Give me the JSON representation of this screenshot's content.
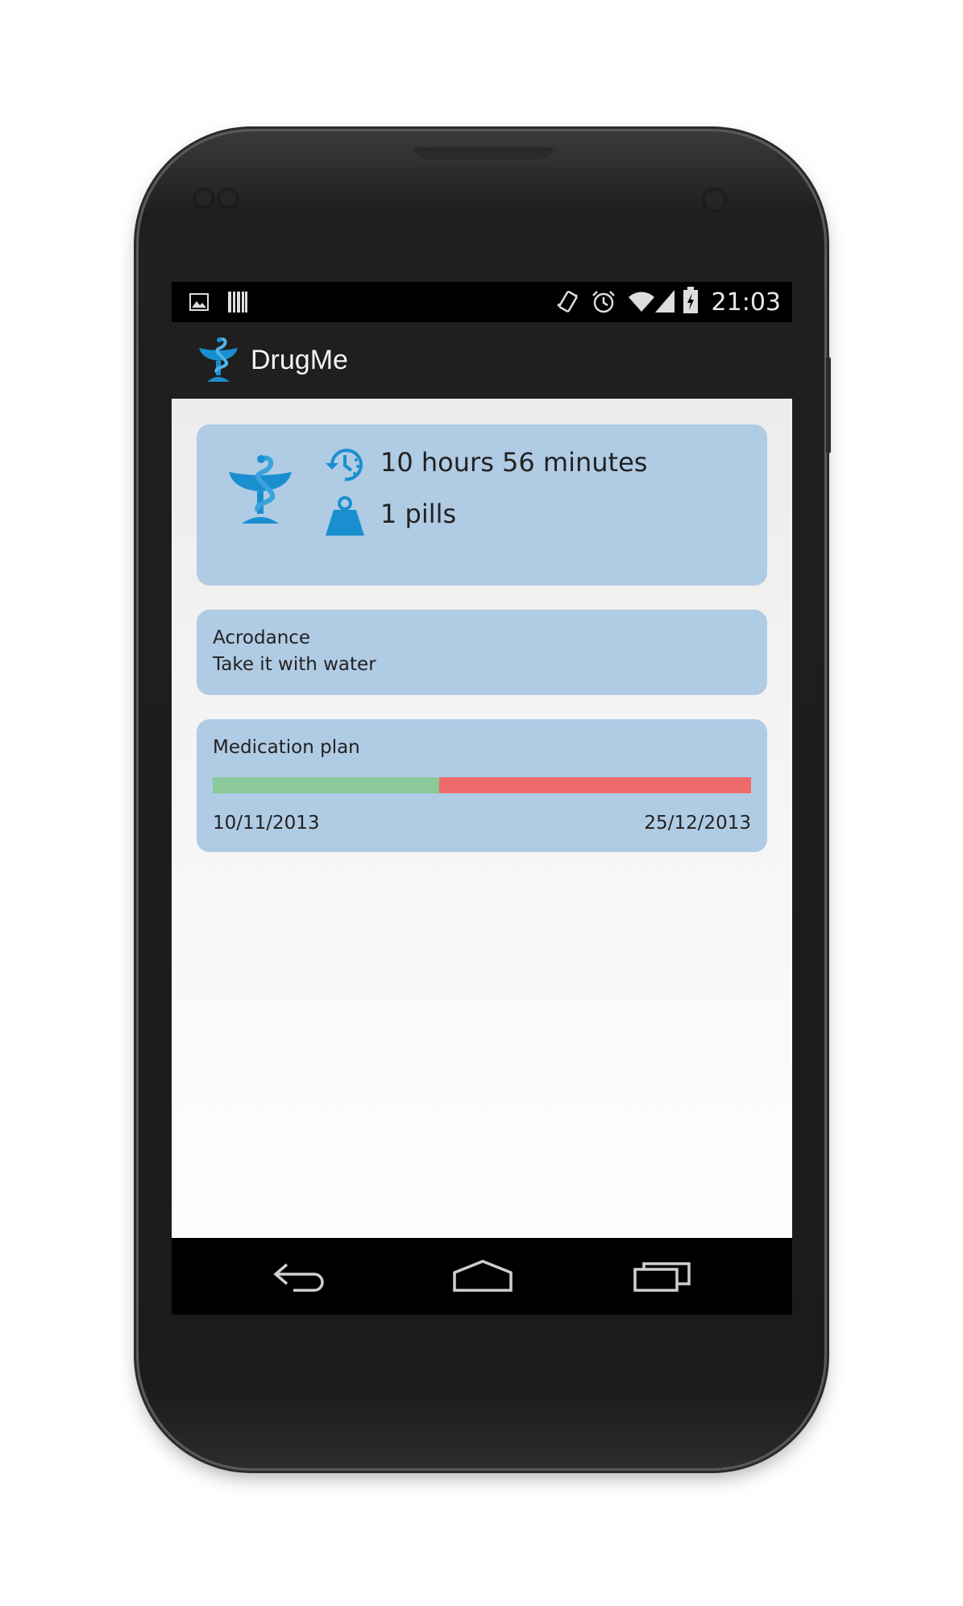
{
  "statusbar": {
    "time": "21:03"
  },
  "actionbar": {
    "title": "DrugMe",
    "icon": "caduceus-icon"
  },
  "next_dose": {
    "time_remaining": "10 hours 56 minutes",
    "dosage": "1 pills",
    "icons": [
      "timer-icon",
      "weight-icon"
    ]
  },
  "drug": {
    "name": "Acrodance",
    "instruction": "Take it with water"
  },
  "plan": {
    "title": "Medication plan",
    "start_date": "10/11/2013",
    "end_date": "25/12/2013",
    "progress_fraction": 0.42
  },
  "colors": {
    "card": "#b0cbe4",
    "accent": "#1a8fd0",
    "progress_done": "#8bc89a",
    "progress_remaining": "#ef6b6b"
  },
  "navbar": [
    "back-icon",
    "home-icon",
    "recent-apps-icon"
  ]
}
